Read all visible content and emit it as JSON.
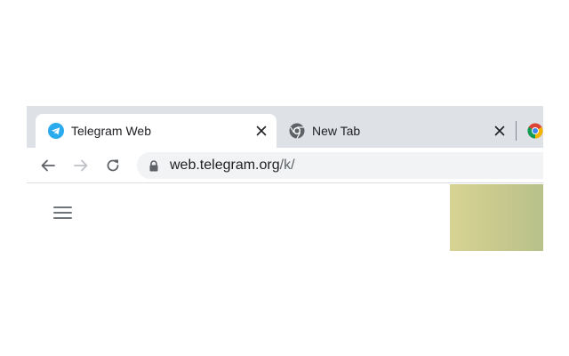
{
  "tabs": [
    {
      "label": "Telegram Web",
      "favicon": "telegram-icon",
      "active": true,
      "close_label": "✕"
    },
    {
      "label": "New Tab",
      "favicon": "chrome-newtab-icon",
      "active": false,
      "close_label": "✕"
    }
  ],
  "partial_tab": {
    "favicon": "chrome-icon"
  },
  "toolbar": {
    "back": "arrow-left-icon",
    "forward": "arrow-right-icon",
    "reload": "reload-icon"
  },
  "omnibox": {
    "lock": "lock-icon",
    "host": "web.telegram.org",
    "path": "/k/"
  },
  "page": {
    "menu": "hamburger-menu-icon"
  },
  "colors": {
    "tabstrip": "#dee1e6",
    "omnibox": "#f1f3f4",
    "telegram_blue": "#2aabee",
    "text": "#202124",
    "muted": "#5f6368",
    "chat_background": "#c9c98e"
  }
}
